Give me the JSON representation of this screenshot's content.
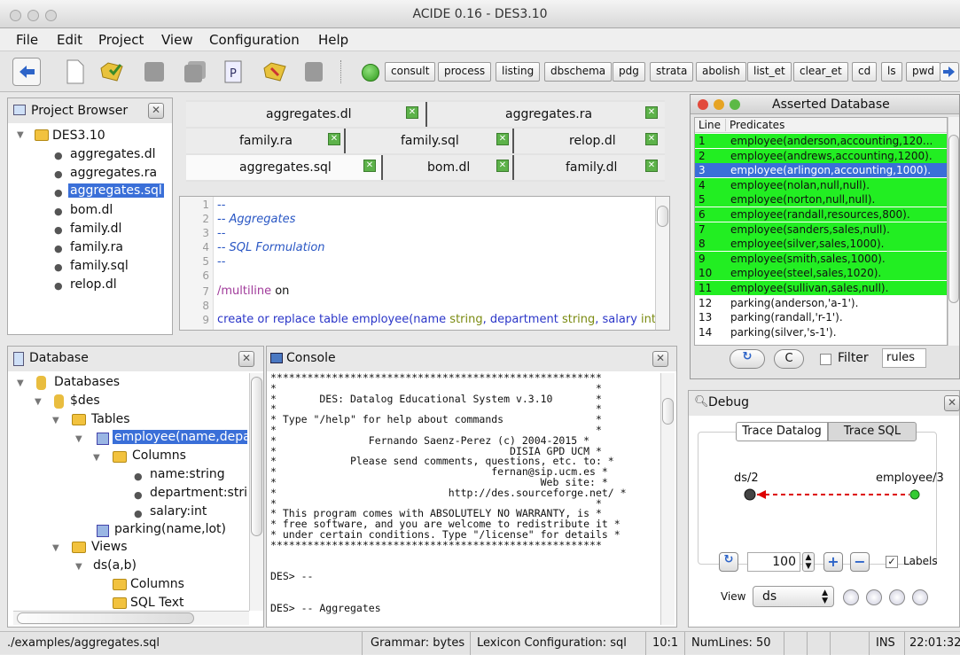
{
  "window": {
    "title": "ACIDE 0.16 - DES3.10"
  },
  "menu": [
    "File",
    "Edit",
    "Project",
    "View",
    "Configuration",
    "Help"
  ],
  "commands": [
    "consult",
    "process",
    "listing",
    "dbschema",
    "pdg",
    "strata",
    "abolish",
    "list_et",
    "clear_et",
    "cd",
    "ls",
    "pwd"
  ],
  "project": {
    "title": "Project Browser",
    "root": "DES3.10",
    "files": [
      "aggregates.dl",
      "aggregates.ra",
      "aggregates.sql",
      "bom.dl",
      "family.dl",
      "family.ra",
      "family.sql",
      "relop.dl"
    ]
  },
  "tabs": {
    "row1": [
      "aggregates.dl",
      "aggregates.ra"
    ],
    "row2": [
      "family.ra",
      "family.sql",
      "relop.dl"
    ],
    "row3": [
      "aggregates.sql",
      "bom.dl",
      "family.dl"
    ]
  },
  "editor": {
    "lines": [
      "1",
      "2",
      "3",
      "4",
      "5",
      "6",
      "7",
      "8",
      "9"
    ],
    "line1": "--",
    "line2": "-- Aggregates",
    "line3": "--",
    "line4": "-- SQL Formulation",
    "line5": "--",
    "line7a": "/multiline",
    "line7b": " on",
    "line9a": "create or replace table employee(name",
    "line9b": " string",
    "line9c": ", department",
    "line9d": " string",
    "line9e": ", salary",
    "line9f": " int",
    "line9g": ");"
  },
  "asserted": {
    "title": "Asserted Database",
    "col_line": "Line",
    "col_pred": "Predicates",
    "rows": [
      {
        "n": "1",
        "p": "employee(anderson,accounting,120..."
      },
      {
        "n": "2",
        "p": "employee(andrews,accounting,1200)."
      },
      {
        "n": "3",
        "p": "employee(arlingon,accounting,1000)."
      },
      {
        "n": "4",
        "p": "employee(nolan,null,null)."
      },
      {
        "n": "5",
        "p": "employee(norton,null,null)."
      },
      {
        "n": "6",
        "p": "employee(randall,resources,800)."
      },
      {
        "n": "7",
        "p": "employee(sanders,sales,null)."
      },
      {
        "n": "8",
        "p": "employee(silver,sales,1000)."
      },
      {
        "n": "9",
        "p": "employee(smith,sales,1000)."
      },
      {
        "n": "10",
        "p": "employee(steel,sales,1020)."
      },
      {
        "n": "11",
        "p": "employee(sullivan,sales,null)."
      },
      {
        "n": "12",
        "p": "parking(anderson,'a-1')."
      },
      {
        "n": "13",
        "p": "parking(randall,'r-1')."
      },
      {
        "n": "14",
        "p": "parking(silver,'s-1')."
      }
    ],
    "refresh": "C",
    "filter": "Filter",
    "rules": "rules"
  },
  "database": {
    "title": "Database",
    "databases": "Databases",
    "des": "$des",
    "tables": "Tables",
    "employee": "employee(name,depart",
    "columns": "Columns",
    "col1": "name:string",
    "col2": "department:string",
    "col3": "salary:int",
    "parking": "parking(name,lot)",
    "views": "Views",
    "ds": "ds(a,b)",
    "vcolumns": "Columns",
    "sqltext": "SQL Text"
  },
  "console": {
    "title": "Console",
    "text": "******************************************************\n*                                                    *\n*       DES: Datalog Educational System v.3.10       *\n*                                                    *\n* Type \"/help\" for help about commands               *\n*                                                    *\n*               Fernando Saenz-Perez (c) 2004-2015 *\n*                                      DISIA GPD UCM *\n*            Please send comments, questions, etc. to: *\n*                                   fernan@sip.ucm.es *\n*                                           Web site: *\n*                            http://des.sourceforge.net/ *\n*                                                    *\n* This program comes with ABSOLUTELY NO WARRANTY, is *\n* free software, and you are welcome to redistribute it *\n* under certain conditions. Type \"/license\" for details *\n******************************************************\n\n\nDES> --\n\n\nDES> -- Aggregates"
  },
  "debug": {
    "title": "Debug",
    "tab1": "Trace Datalog",
    "tab2": "Trace SQL",
    "node1": "ds/2",
    "node2": "employee/3",
    "zoom": "100",
    "labels": "Labels",
    "view_label": "View",
    "view_value": "ds"
  },
  "status": {
    "file": "./examples/aggregates.sql",
    "grammar": "Grammar: bytes",
    "lexicon": "Lexicon Configuration: sql",
    "pos": "10:1",
    "numlines": "NumLines: 50",
    "ins": "INS",
    "time": "22:01:32"
  },
  "colors": {
    "highlight": "#22ee22",
    "selection": "#3a6fd8",
    "arrow": "#dd0000"
  }
}
